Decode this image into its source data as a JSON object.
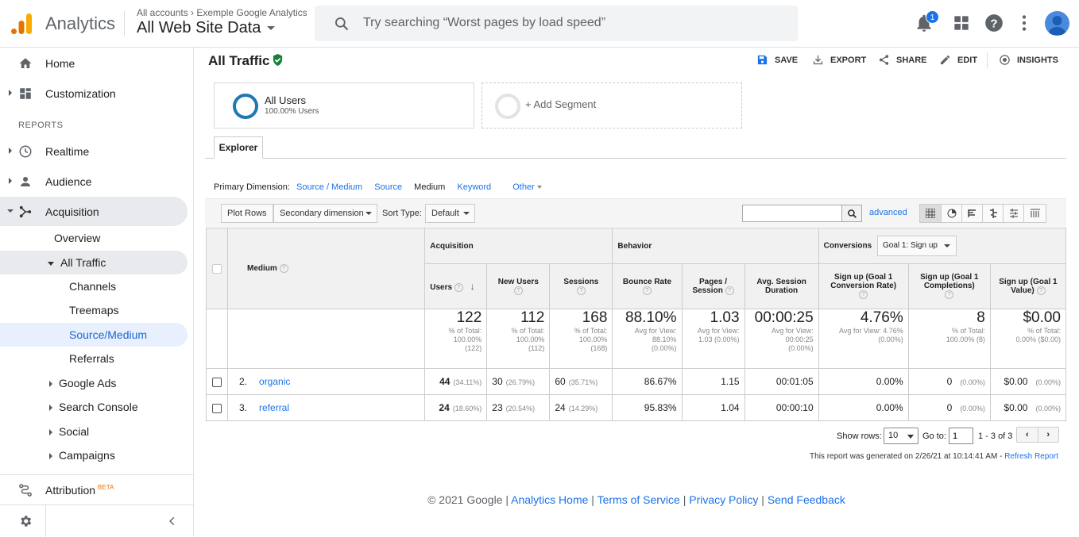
{
  "header": {
    "app_name": "Analytics",
    "crumb": "All accounts › Exemple Google Analytics",
    "view": "All Web Site Data",
    "search_placeholder": "Try searching “Worst pages by load speed”",
    "notification_count": "1"
  },
  "sidebar": {
    "home": "Home",
    "customization": "Customization",
    "reports_label": "REPORTS",
    "realtime": "Realtime",
    "audience": "Audience",
    "acquisition": "Acquisition",
    "overview": "Overview",
    "all_traffic": "All Traffic",
    "channels": "Channels",
    "treemaps": "Treemaps",
    "source_medium": "Source/Medium",
    "referrals": "Referrals",
    "google_ads": "Google Ads",
    "search_console": "Search Console",
    "social": "Social",
    "campaigns": "Campaigns",
    "attribution": "Attribution",
    "beta": "BETA"
  },
  "page": {
    "title": "All Traffic",
    "save": "SAVE",
    "export": "EXPORT",
    "share": "SHARE",
    "edit": "EDIT",
    "insights": "INSIGHTS"
  },
  "segments": {
    "seg1_name": "All Users",
    "seg1_sub": "100.00% Users",
    "add": "+ Add Segment"
  },
  "explorer": {
    "tab": "Explorer",
    "primary_dim_label": "Primary Dimension:",
    "dims": [
      "Source / Medium",
      "Source",
      "Medium",
      "Keyword",
      "Other"
    ],
    "plot_rows": "Plot Rows",
    "secondary_dim": "Secondary dimension",
    "sort_type_label": "Sort Type:",
    "sort_type": "Default",
    "advanced": "advanced"
  },
  "table": {
    "group_acq": "Acquisition",
    "group_beh": "Behavior",
    "group_conv": "Conversions",
    "goal_select": "Goal 1: Sign up",
    "col_medium": "Medium",
    "cols": [
      "Users",
      "New Users",
      "Sessions",
      "Bounce Rate",
      "Pages / Session",
      "Avg. Session Duration",
      "Sign up (Goal 1 Conversion Rate)",
      "Sign up (Goal 1 Completions)",
      "Sign up (Goal 1 Value)"
    ],
    "totals": [
      {
        "big": "122",
        "s1": "% of Total:",
        "s2": "100.00%",
        "s3": "(122)"
      },
      {
        "big": "112",
        "s1": "% of Total:",
        "s2": "100.00%",
        "s3": "(112)"
      },
      {
        "big": "168",
        "s1": "% of Total:",
        "s2": "100.00%",
        "s3": "(168)"
      },
      {
        "big": "88.10%",
        "s1": "Avg for View:",
        "s2": "88.10%",
        "s3": "(0.00%)"
      },
      {
        "big": "1.03",
        "s1": "Avg for View:",
        "s2": "1.03 (0.00%)",
        "s3": ""
      },
      {
        "big": "00:00:25",
        "s1": "Avg for View:",
        "s2": "00:00:25",
        "s3": "(0.00%)"
      },
      {
        "big": "4.76%",
        "s1": "Avg for View: 4.76%",
        "s2": "(0.00%)",
        "s3": ""
      },
      {
        "big": "8",
        "s1": "% of Total:",
        "s2": "100.00% (8)",
        "s3": ""
      },
      {
        "big": "$0.00",
        "s1": "% of Total:",
        "s2": "0.00% ($0.00)",
        "s3": ""
      }
    ],
    "rows": [
      {
        "idx": "2.",
        "medium": "organic",
        "users": "44",
        "users_pct": "(34.11%)",
        "new": "30",
        "new_pct": "(26.79%)",
        "sess": "60",
        "sess_pct": "(35.71%)",
        "bounce": "86.67%",
        "pps": "1.15",
        "dur": "00:01:05",
        "conv": "0.00%",
        "comp": "0",
        "comp_pct": "(0.00%)",
        "val": "$0.00",
        "val_pct": "(0.00%)"
      },
      {
        "idx": "3.",
        "medium": "referral",
        "users": "24",
        "users_pct": "(18.60%)",
        "new": "23",
        "new_pct": "(20.54%)",
        "sess": "24",
        "sess_pct": "(14.29%)",
        "bounce": "95.83%",
        "pps": "1.04",
        "dur": "00:00:10",
        "conv": "0.00%",
        "comp": "0",
        "comp_pct": "(0.00%)",
        "val": "$0.00",
        "val_pct": "(0.00%)"
      }
    ],
    "show_rows_label": "Show rows:",
    "show_rows": "10",
    "goto_label": "Go to:",
    "goto_value": "1",
    "range": "1 - 3 of 3",
    "generated": "This report was generated on 2/26/21 at 10:14:41 AM -",
    "refresh": "Refresh Report"
  },
  "footer": {
    "copy": "© 2021 Google",
    "links": [
      "Analytics Home",
      "Terms of Service",
      "Privacy Policy",
      "Send Feedback"
    ]
  }
}
